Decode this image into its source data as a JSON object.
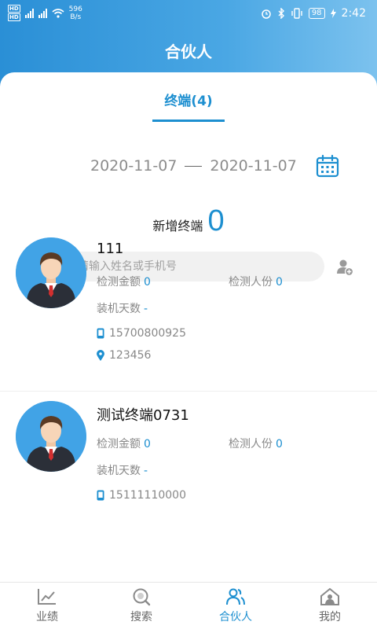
{
  "status_bar": {
    "network_speed_value": "596",
    "network_speed_unit": "B/s",
    "battery": "98",
    "time": "2:42"
  },
  "header": {
    "title": "合伙人"
  },
  "tab": {
    "label": "终端(4)"
  },
  "date_range": {
    "start": "2020-11-07",
    "end": "2020-11-07"
  },
  "summary": {
    "label": "新增终端",
    "count": "0"
  },
  "search": {
    "placeholder": "请输入姓名或手机号",
    "value": ""
  },
  "list": {
    "items": [
      {
        "name": "111",
        "amount_label": "检测金额",
        "amount_value": "0",
        "people_label": "检测人份",
        "people_value": "0",
        "days_label": "装机天数",
        "days_value": "-",
        "phone": "15700800925",
        "address": "123456"
      },
      {
        "name": "测试终端0731",
        "amount_label": "检测金额",
        "amount_value": "0",
        "people_label": "检测人份",
        "people_value": "0",
        "days_label": "装机天数",
        "days_value": "-",
        "phone": "15111110000"
      }
    ]
  },
  "tabbar": {
    "items": [
      {
        "label": "业绩",
        "icon": "chart-icon"
      },
      {
        "label": "搜索",
        "icon": "search-icon"
      },
      {
        "label": "合伙人",
        "icon": "partner-icon"
      },
      {
        "label": "我的",
        "icon": "home-user-icon"
      }
    ],
    "active_index": 2
  },
  "colors": {
    "accent": "#1d8fd0",
    "header_gradient_start": "#2a8fd6",
    "header_gradient_end": "#7cc2ee"
  }
}
